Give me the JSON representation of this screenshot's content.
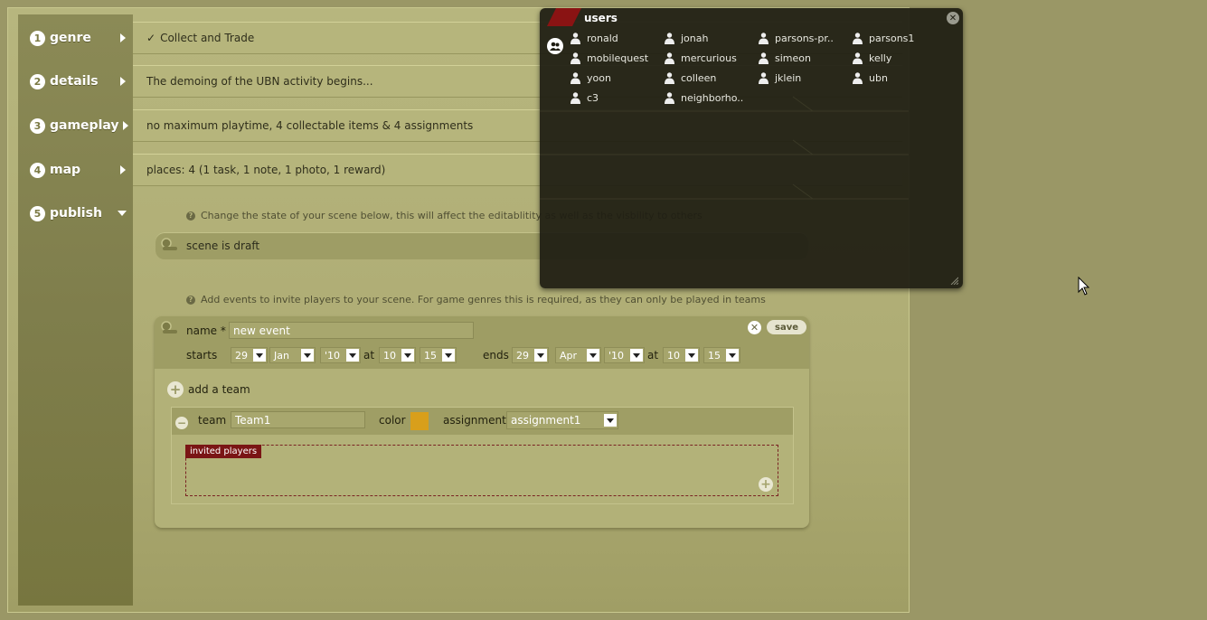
{
  "steps": [
    {
      "num": "1",
      "label": "genre",
      "value": "Collect and Trade",
      "checked": true
    },
    {
      "num": "2",
      "label": "details",
      "value": "The demoing of the UBN activity begins..."
    },
    {
      "num": "3",
      "label": "gameplay",
      "value": "no maximum playtime, 4 collectable items & 4 assignments"
    },
    {
      "num": "4",
      "label": "map",
      "value": "places: 4 (1 task, 1 note, 1 photo, 1 reward)"
    },
    {
      "num": "5",
      "label": "publish",
      "value": ""
    }
  ],
  "publish": {
    "state_info": "Change the state of your scene below, this will affect the editablitity as well as the visbility to others",
    "scene_state": "scene is draft",
    "events_info": "Add events to invite players to your scene. For game genres this is required, as they can only be played in teams"
  },
  "event": {
    "name_label": "name *",
    "name_value": "new event",
    "save_label": "save",
    "starts_label": "starts",
    "ends_label": "ends",
    "at_label": "at",
    "start": {
      "day": "29",
      "month": "Jan",
      "year": "'10",
      "hour": "10",
      "minute": "15"
    },
    "end": {
      "day": "29",
      "month": "Apr",
      "year": "'10",
      "hour": "10",
      "minute": "15"
    },
    "add_team_label": "add a team",
    "team": {
      "team_label": "team",
      "team_value": "Team1",
      "color_label": "color",
      "color": "#d89f1b",
      "assignment_label": "assignment",
      "assignment_value": "assignment1",
      "invited_label": "invited players"
    }
  },
  "users_panel": {
    "title": "users",
    "users": [
      "ronald",
      "jonah",
      "parsons-pr..",
      "parsons1",
      "mobilequest",
      "mercurious",
      "simeon",
      "kelly",
      "yoon",
      "colleen",
      "jklein",
      "ubn",
      "c3",
      "neighborho.."
    ]
  },
  "colors": {
    "background": "#9a9766",
    "accent_red": "#8a1313",
    "panel_bg": "#1e1d12"
  }
}
